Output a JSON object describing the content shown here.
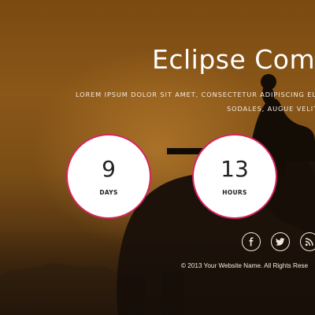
{
  "hero": {
    "title": "Eclipse Com",
    "subtitle_line1": "LOREM IPSUM DOLOR SIT AMET, CONSECTETUR ADIPISCING ELIT",
    "subtitle_line2": "SODALES, AUGUE VELIT"
  },
  "countdown": [
    {
      "value": "9",
      "label": "DAYS"
    },
    {
      "value": "13",
      "label": "HOURS"
    }
  ],
  "social": [
    {
      "icon": "facebook-icon"
    },
    {
      "icon": "twitter-icon"
    },
    {
      "icon": "rss-icon"
    }
  ],
  "footer": {
    "copyright": "© 2013 Your Website Name. All Rights Rese"
  },
  "colors": {
    "accent": "#d6245e",
    "text_light": "#f3eadf"
  }
}
